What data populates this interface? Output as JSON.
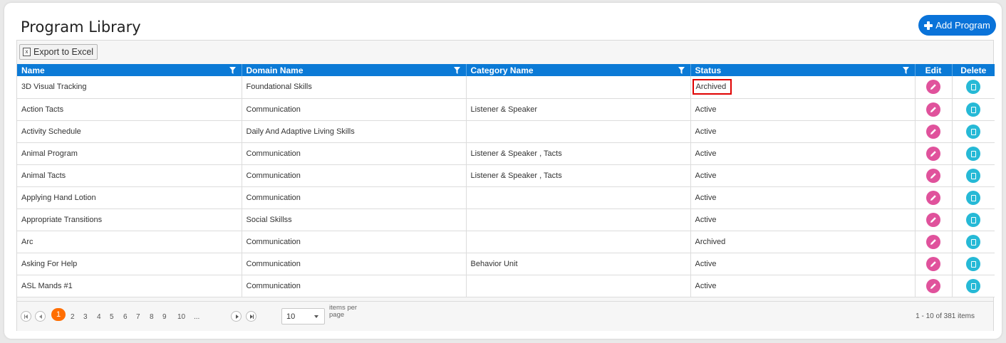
{
  "page": {
    "title": "Program Library",
    "add_button": "Add Program"
  },
  "toolbar": {
    "export_label": "Export to Excel"
  },
  "grid": {
    "columns": {
      "name": "Name",
      "domain": "Domain Name",
      "category": "Category Name",
      "status": "Status",
      "edit": "Edit",
      "delete": "Delete"
    },
    "rows": [
      {
        "name": "3D Visual Tracking",
        "domain": "Foundational Skills",
        "category": "",
        "status": "Archived"
      },
      {
        "name": "Action Tacts",
        "domain": "Communication",
        "category": "Listener & Speaker",
        "status": "Active"
      },
      {
        "name": "Activity Schedule",
        "domain": "Daily And Adaptive Living Skills",
        "category": "",
        "status": "Active"
      },
      {
        "name": "Animal Program",
        "domain": "Communication",
        "category": "Listener & Speaker , Tacts",
        "status": "Active"
      },
      {
        "name": "Animal Tacts",
        "domain": "Communication",
        "category": "Listener & Speaker , Tacts",
        "status": "Active"
      },
      {
        "name": "Applying Hand Lotion",
        "domain": "Communication",
        "category": "",
        "status": "Active"
      },
      {
        "name": "Appropriate Transitions",
        "domain": "Social Skillss",
        "category": "",
        "status": "Active"
      },
      {
        "name": "Arc",
        "domain": "Communication",
        "category": "",
        "status": "Archived"
      },
      {
        "name": "Asking For Help",
        "domain": "Communication",
        "category": "Behavior Unit",
        "status": "Active"
      },
      {
        "name": "ASL Mands #1",
        "domain": "Communication",
        "category": "",
        "status": "Active"
      }
    ]
  },
  "pager": {
    "current_page": "1",
    "pages": [
      "2",
      "3",
      "4",
      "5",
      "6",
      "7",
      "8",
      "9",
      "10",
      "..."
    ],
    "page_size": "10",
    "items_per_page_label": "items per page",
    "info": "1 - 10 of 381 items"
  },
  "colors": {
    "header_blue": "#0b7ad6",
    "button_blue": "#0a73d9",
    "edit_pink": "#e0529c",
    "delete_cyan": "#26b9d6",
    "pager_active": "#ff6d00",
    "highlight_red": "#e00000"
  },
  "icons": {
    "add": "plus-icon",
    "export": "excel-icon",
    "filter": "filter-icon",
    "edit": "pencil-icon",
    "delete": "trash-icon"
  }
}
